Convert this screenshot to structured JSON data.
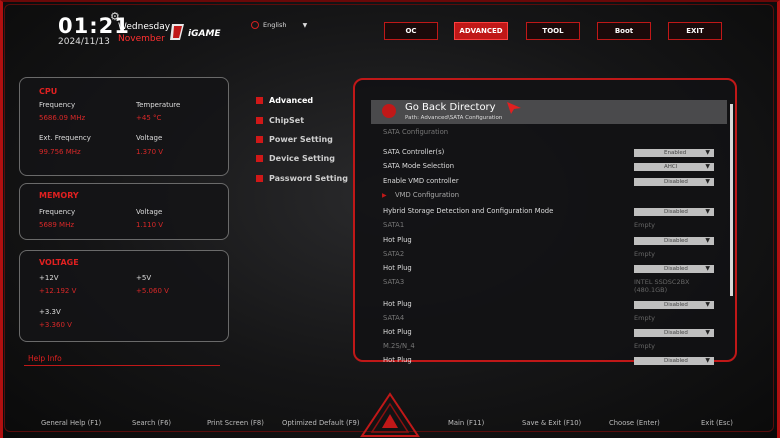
{
  "header": {
    "time": "01:21",
    "date": "2024/11/13",
    "weekday": "Wednesday",
    "month": "November",
    "brand": "iGAME",
    "language": "English",
    "nav": [
      {
        "label": "OC",
        "active": false
      },
      {
        "label": "ADVANCED",
        "active": true
      },
      {
        "label": "TOOL",
        "active": false
      },
      {
        "label": "Boot",
        "active": false
      },
      {
        "label": "EXIT",
        "active": false
      }
    ]
  },
  "cpu": {
    "title": "CPU",
    "freq_label": "Frequency",
    "freq_value": "5686.09 MHz",
    "temp_label": "Temperature",
    "temp_value": "+45 °C",
    "ext_label": "Ext. Frequency",
    "ext_value": "99.756 MHz",
    "volt_label": "Voltage",
    "volt_value": "1.370 V"
  },
  "memory": {
    "title": "MEMORY",
    "freq_label": "Frequency",
    "freq_value": "5689 MHz",
    "volt_label": "Voltage",
    "volt_value": "1.110 V"
  },
  "voltage": {
    "title": "VOLTAGE",
    "v12_label": "+12V",
    "v12_value": "+12.192 V",
    "v5_label": "+5V",
    "v5_value": "+5.060 V",
    "v33_label": "+3.3V",
    "v33_value": "+3.360 V"
  },
  "help_info": "Help Info",
  "menu": [
    {
      "label": "Advanced",
      "active": true
    },
    {
      "label": "ChipSet",
      "active": false
    },
    {
      "label": "Power Setting",
      "active": false
    },
    {
      "label": "Device Setting",
      "active": false
    },
    {
      "label": "Password Setting",
      "active": false
    }
  ],
  "panel": {
    "go_back": "Go Back Directory",
    "path": "Path: Advanced\\SATA Configuration",
    "section_title": "SATA Configuration",
    "rows": [
      {
        "label": "SATA Controller(s)",
        "value": "Enabled",
        "kind": "dropdown"
      },
      {
        "label": "SATA Mode Selection",
        "value": "AHCI",
        "kind": "dropdown"
      },
      {
        "label": "Enable VMD controller",
        "value": "Disabled",
        "kind": "dropdown"
      },
      {
        "label": "VMD Configuration",
        "value": "",
        "kind": "submenu"
      },
      {
        "label": "Hybrid Storage Detection and Configuration Mode",
        "value": "Disabled",
        "kind": "dropdown"
      },
      {
        "label": "SATA1",
        "value": "Empty",
        "kind": "info"
      },
      {
        "label": "Hot Plug",
        "value": "Disabled",
        "kind": "dropdown"
      },
      {
        "label": "SATA2",
        "value": "Empty",
        "kind": "info"
      },
      {
        "label": "Hot Plug",
        "value": "Disabled",
        "kind": "dropdown"
      },
      {
        "label": "SATA3",
        "value": "INTEL SSDSC2BX",
        "value2": "(480.1GB)",
        "kind": "info2"
      },
      {
        "label": "Hot Plug",
        "value": "Disabled",
        "kind": "dropdown"
      },
      {
        "label": "SATA4",
        "value": "Empty",
        "kind": "info"
      },
      {
        "label": "Hot Plug",
        "value": "Disabled",
        "kind": "dropdown"
      },
      {
        "label": "M.2S/N_4",
        "value": "Empty",
        "kind": "info"
      },
      {
        "label": "Hot Plug",
        "value": "Disabled",
        "kind": "dropdown"
      }
    ]
  },
  "footer": [
    "General Help (F1)",
    "Search (F6)",
    "Print Screen (F8)",
    "Optimized Default (F9)",
    "Main (F11)",
    "Save & Exit (F10)",
    "Choose (Enter)",
    "Exit (Esc)"
  ],
  "colors": {
    "accent": "#c01818",
    "bright_accent": "#e02020",
    "panel_bg": "#121214"
  }
}
